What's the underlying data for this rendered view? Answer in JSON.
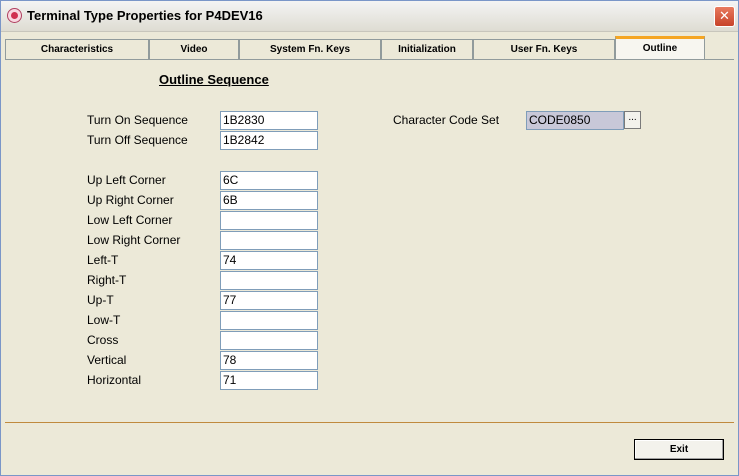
{
  "window": {
    "title": "Terminal Type Properties for P4DEV16",
    "icon": "app-icon",
    "close_glyph": "✕"
  },
  "tabs": [
    {
      "label": "Characteristics"
    },
    {
      "label": "Video"
    },
    {
      "label": "System Fn. Keys"
    },
    {
      "label": "Initialization"
    },
    {
      "label": "User Fn. Keys"
    },
    {
      "label": "Outline",
      "active": true
    }
  ],
  "section": {
    "title": "Outline Sequence"
  },
  "sequences": {
    "turn_on": {
      "label": "Turn On Sequence",
      "value": "1B2830"
    },
    "turn_off": {
      "label": "Turn Off Sequence",
      "value": "1B2842"
    }
  },
  "charset": {
    "label": "Character Code Set",
    "value": "CODE0850",
    "browse_label": "..."
  },
  "chars": [
    {
      "label": "Up Left Corner",
      "value": "6C"
    },
    {
      "label": "Up Right Corner",
      "value": "6B"
    },
    {
      "label": "Low Left Corner",
      "value": ""
    },
    {
      "label": "Low Right Corner",
      "value": ""
    },
    {
      "label": "Left-T",
      "value": "74"
    },
    {
      "label": "Right-T",
      "value": ""
    },
    {
      "label": "Up-T",
      "value": "77"
    },
    {
      "label": "Low-T",
      "value": ""
    },
    {
      "label": "Cross",
      "value": ""
    },
    {
      "label": "Vertical",
      "value": "78"
    },
    {
      "label": "Horizontal",
      "value": "71"
    }
  ],
  "footer": {
    "exit_label": "Exit"
  },
  "colors": {
    "active_tab_accent": "#f5a623",
    "separator": "#c08a3e",
    "window_bg": "#ece9d8"
  }
}
